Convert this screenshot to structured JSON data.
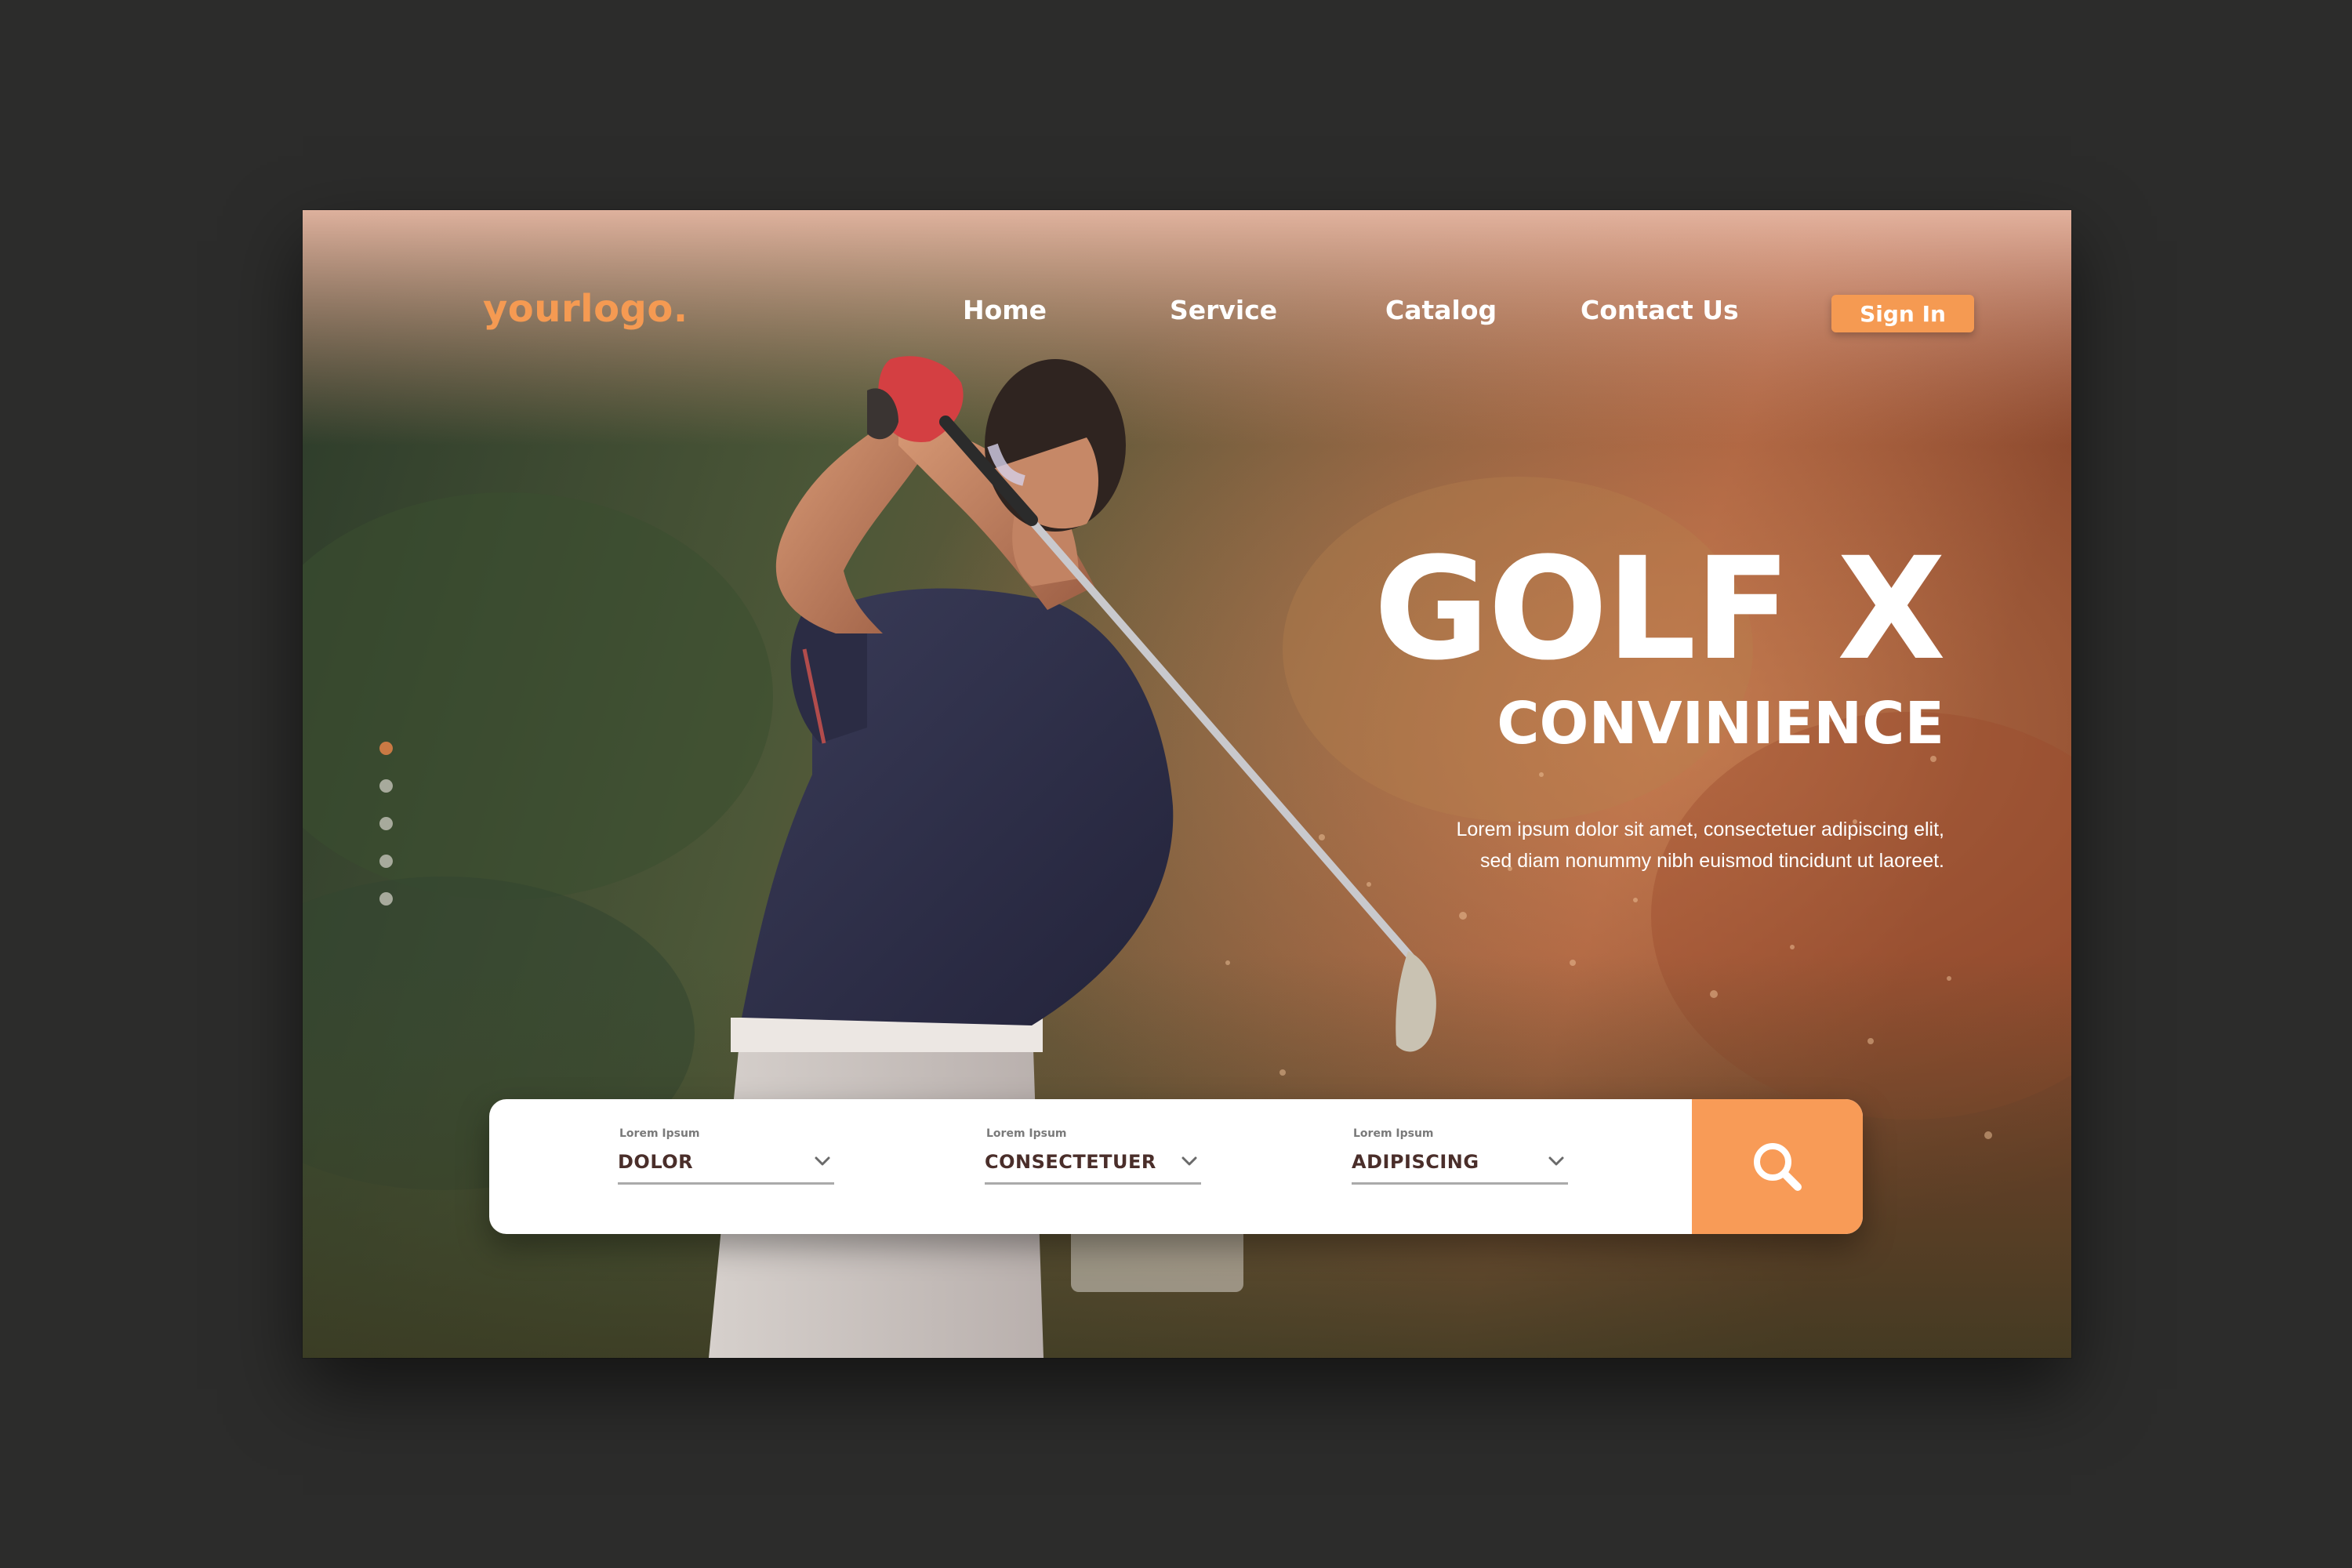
{
  "header": {
    "logo": "yourlogo.",
    "nav": [
      "Home",
      "Service",
      "Catalog",
      "Contact Us"
    ],
    "signin_label": "Sign In"
  },
  "hero": {
    "title": "GOLF X",
    "subtitle": "CONVINIENCE",
    "description": "Lorem ipsum dolor sit amet, consectetuer adipiscing elit, sed diam nonummy nibh euismod tincidunt ut laoreet."
  },
  "carousel": {
    "count": 5,
    "active_index": 0
  },
  "search": {
    "fields": [
      {
        "label": "Lorem Ipsum",
        "value": "DOLOR"
      },
      {
        "label": "Lorem Ipsum",
        "value": "CONSECTETUER"
      },
      {
        "label": "Lorem Ipsum",
        "value": "ADIPISCING"
      }
    ],
    "button_icon": "search-icon"
  },
  "colors": {
    "accent": "#f59a52",
    "frame": "#2c2c2b",
    "field_text": "#4a2e2a"
  }
}
